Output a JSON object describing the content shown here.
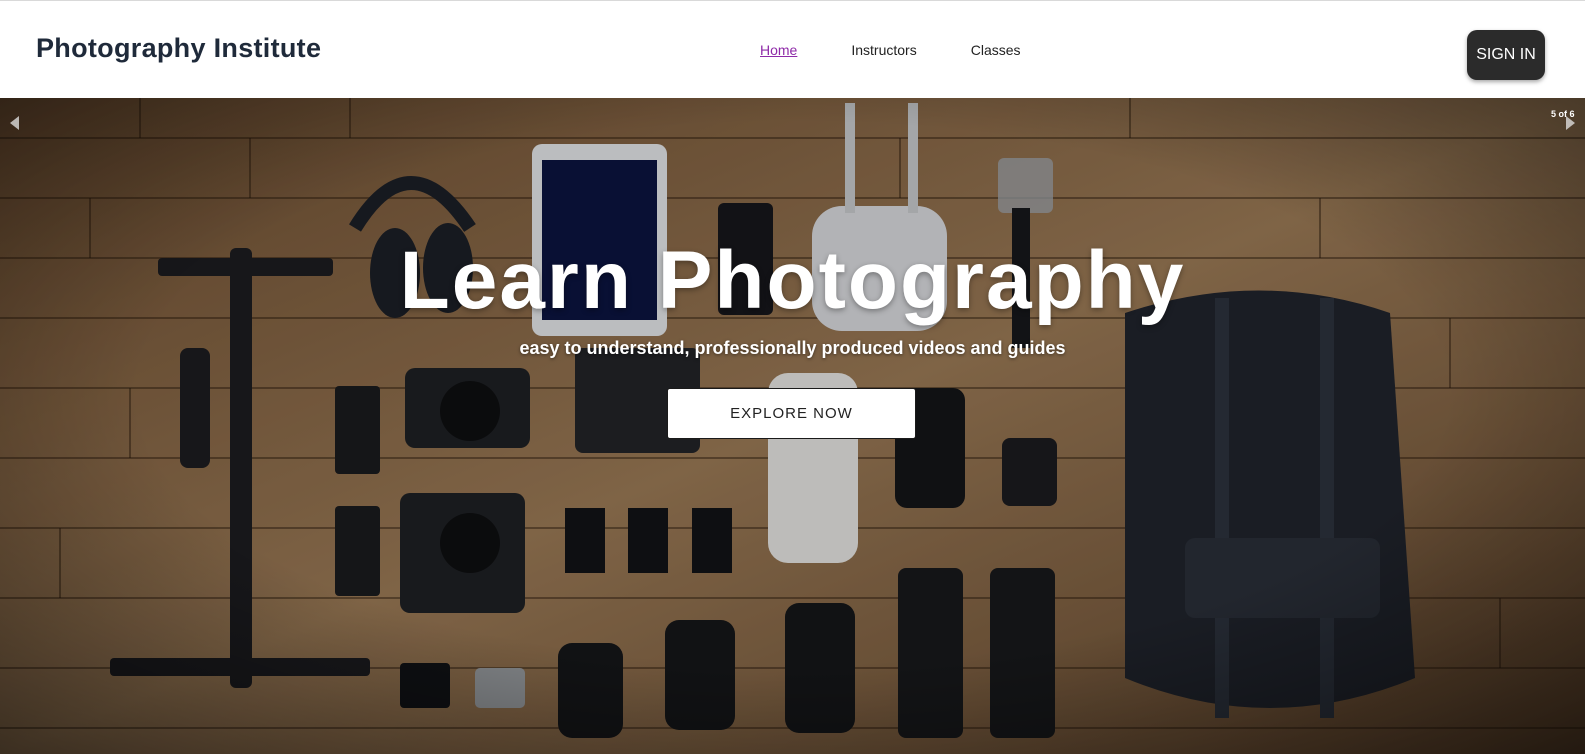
{
  "header": {
    "brand": "Photography Institute",
    "nav": [
      {
        "label": "Home",
        "active": true
      },
      {
        "label": "Instructors",
        "active": false
      },
      {
        "label": "Classes",
        "active": false
      }
    ],
    "signin_label": "SIGN IN"
  },
  "hero": {
    "title": "Learn Photography",
    "subtitle": "easy to understand, professionally produced videos and guides",
    "cta_label": "EXPLORE NOW",
    "slide_counter": "5 of 6",
    "background_image": "flat-lay photo of camera gear on a wooden floor"
  },
  "colors": {
    "brand_text": "#1f2a3a",
    "active_nav": "#8e2aa8",
    "signin_bg": "#2b2b2b",
    "hero_wood": "#8a6a48"
  },
  "icons": [
    "arrow-left-icon",
    "arrow-right-icon"
  ]
}
